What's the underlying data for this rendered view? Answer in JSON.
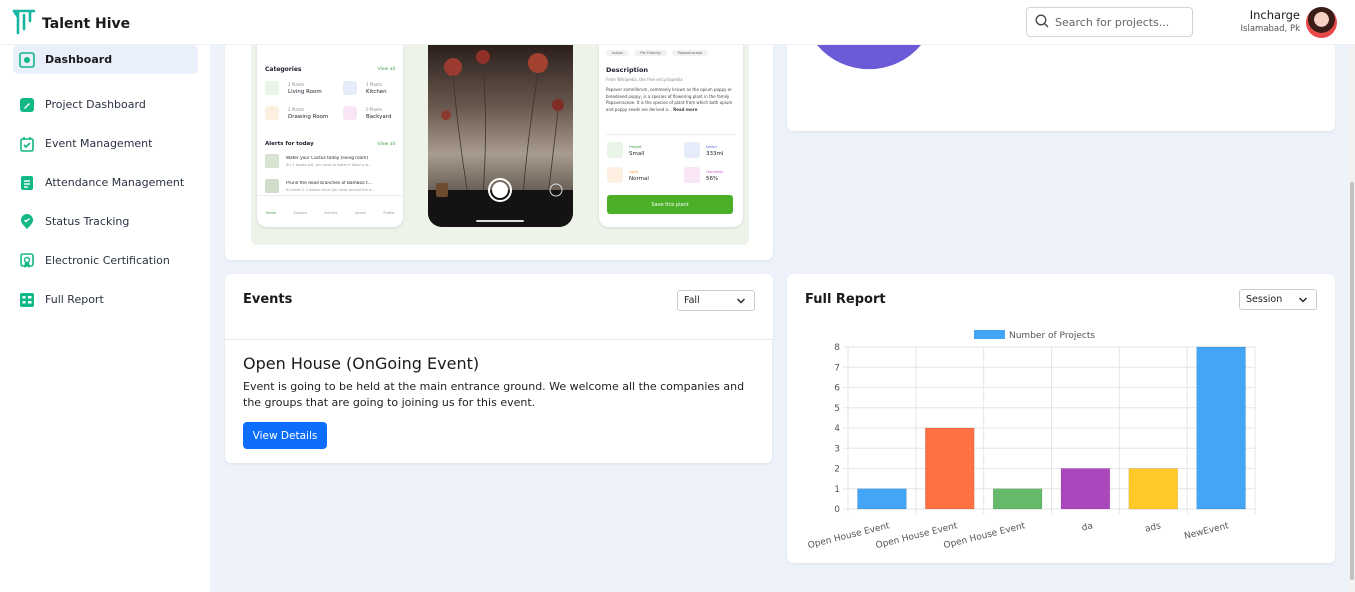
{
  "app": {
    "name": "Talent Hive"
  },
  "search": {
    "placeholder": "Search for projects..."
  },
  "user": {
    "name": "Incharge",
    "location": "Islamabad, Pk"
  },
  "sidebar": {
    "items": [
      {
        "label": "Dashboard",
        "icon": "dashboard-icon",
        "active": true
      },
      {
        "label": "Project Dashboard",
        "icon": "pencil-icon"
      },
      {
        "label": "Event Management",
        "icon": "calendar-check-icon"
      },
      {
        "label": "Attendance Management",
        "icon": "document-icon"
      },
      {
        "label": "Status Tracking",
        "icon": "location-pin-icon"
      },
      {
        "label": "Electronic Certification",
        "icon": "certificate-icon"
      },
      {
        "label": "Full Report",
        "icon": "report-grid-icon"
      }
    ]
  },
  "preview": {
    "categories_title": "Categories",
    "view_all": "View all",
    "categories": [
      {
        "count": "2 Plants",
        "name": "Living Room"
      },
      {
        "count": "1 Plants",
        "name": "Kitchen"
      },
      {
        "count": "2 Plants",
        "name": "Drawing Room"
      },
      {
        "count": "0 Plants",
        "name": "Backyard"
      }
    ],
    "alerts_title": "Alerts for today",
    "alerts": [
      {
        "title": "Water your Cactus today (living room)",
        "sub": "It's 2 weeks old, you have to water it twice a w..."
      },
      {
        "title": "Prune the dead branches of Bamboo t...",
        "sub": "It's been 2-3 weeks since you have pruned the d..."
      }
    ],
    "tabs": [
      "Home",
      "Explore",
      "Articles",
      "Saved",
      "Profile"
    ],
    "tags": [
      "Indoor",
      "Pet Friendly",
      "Papaveraceae"
    ],
    "description_title": "Description",
    "description_source": "From Wikipedia, the free encyclopedia",
    "description_text": "Papaver somniferum, commonly known as the opium poppy or breadseed poppy, is a species of flowering plant in the family Papaveraceae. It is the species of plant from which both opium and poppy seeds are derived a...",
    "read_more": "Read more",
    "stats": [
      {
        "label": "Height",
        "value": "Small"
      },
      {
        "label": "Water",
        "value": "333ml"
      },
      {
        "label": "Light",
        "value": "Normal"
      },
      {
        "label": "Humidity",
        "value": "56%"
      }
    ],
    "save_button": "Save this plant"
  },
  "events": {
    "title": "Events",
    "filter": "Fall",
    "event_title": "Open House (OnGoing Event)",
    "event_description": "Event is going to be held at the main entrance ground. We welcome all the companies and the groups that are going to joining us for this event.",
    "button": "View Details"
  },
  "report": {
    "title": "Full Report",
    "filter": "Session"
  },
  "chart_data": {
    "type": "bar",
    "categories": [
      "Open House Event",
      "Open House Event",
      "Open House Event",
      "da",
      "ads",
      "NewEvent"
    ],
    "series": [
      {
        "name": "Number of Projects",
        "values": [
          1,
          4,
          1,
          2,
          2,
          8
        ]
      }
    ],
    "bar_colors": [
      "#42a5f5",
      "#ff7043",
      "#66bb6a",
      "#ab47bc",
      "#ffca28",
      "#42a5f5"
    ],
    "ylim": [
      0,
      8
    ],
    "yticks": [
      0,
      1,
      2,
      3,
      4,
      5,
      6,
      7,
      8
    ],
    "grid": true,
    "legend": "top"
  }
}
